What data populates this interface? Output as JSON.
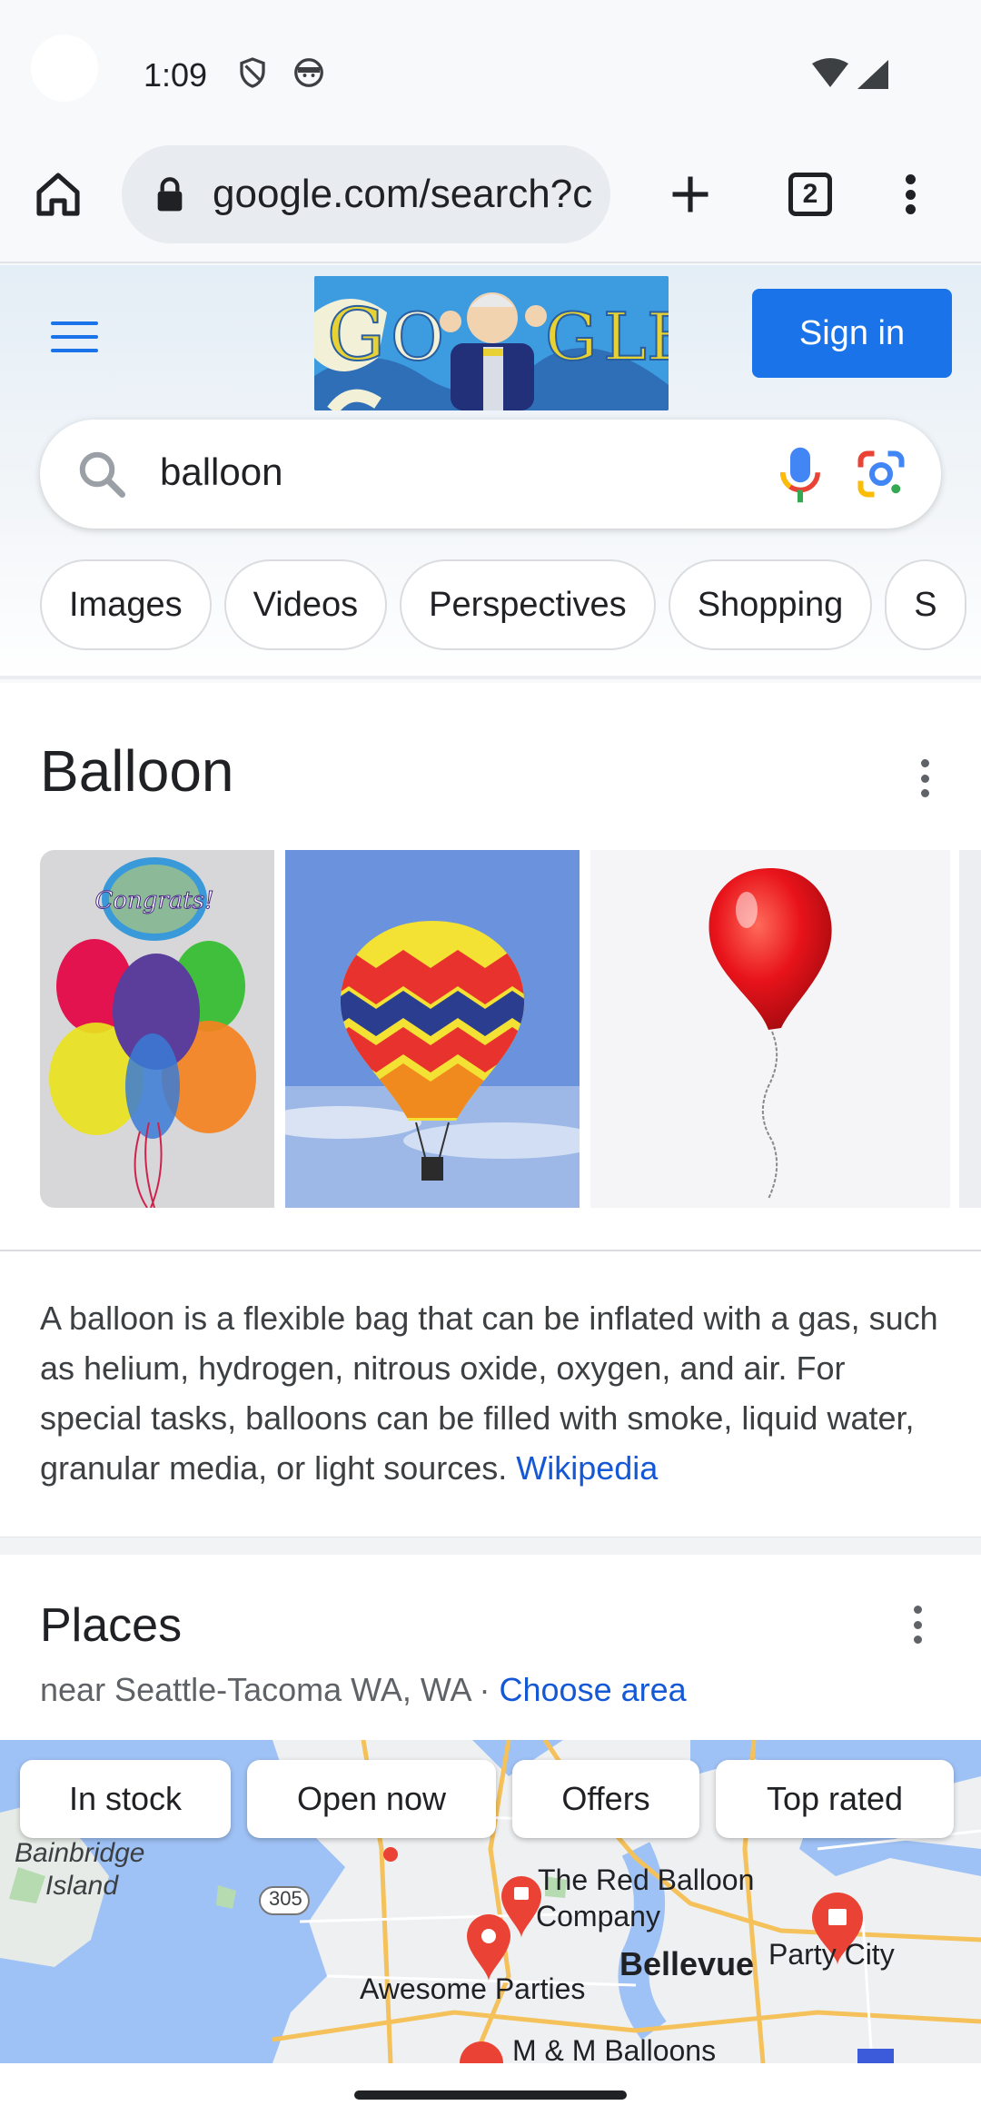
{
  "status_bar": {
    "time": "1:09"
  },
  "browser": {
    "url": "google.com/search?c",
    "tab_count": "2"
  },
  "google": {
    "signin_label": "Sign in",
    "query": "balloon",
    "chips": [
      "Images",
      "Videos",
      "Perspectives",
      "Shopping",
      "S"
    ]
  },
  "knowledge_panel": {
    "title": "Balloon",
    "description": "A balloon is a flexible bag that can be inflated with a gas, such as helium, hydrogen, nitrous oxide, oxygen, and air. For special tasks, balloons can be filled with smoke, liquid water, granular media, or light sources.",
    "source_link": "Wikipedia",
    "balloon_text": "Congrats!"
  },
  "places": {
    "title": "Places",
    "location": "near Seattle-Tacoma WA, WA · ",
    "choose_area": "Choose area",
    "map_chips": [
      "In stock",
      "Open now",
      "Offers",
      "Top rated"
    ],
    "map_labels": {
      "bainbridge": "Bainbridge",
      "island": "Island",
      "red_balloon_1": "The Red Balloon",
      "red_balloon_2": "Company",
      "bellevue": "Bellevue",
      "party_city": "Party City",
      "awesome": "Awesome Parties",
      "route": "305",
      "mm": "M & M Balloons"
    }
  },
  "colors": {
    "accent": "#1a73e8",
    "link": "#1558d6",
    "pin_red": "#ea4335"
  }
}
